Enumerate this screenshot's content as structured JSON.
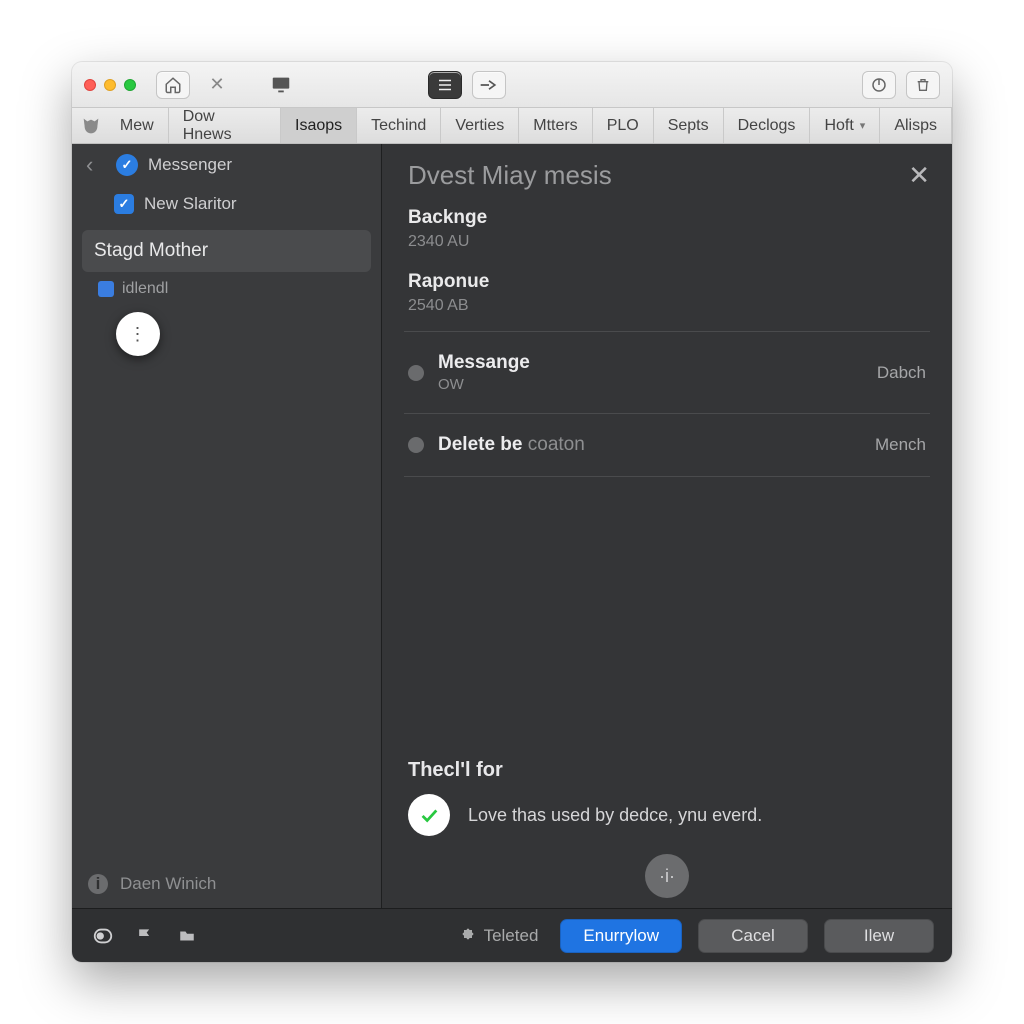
{
  "tabs": [
    "Mew",
    "Dow Hnews",
    "Isaops",
    "Techind",
    "Verties",
    "Mtters",
    "PLO",
    "Septs",
    "Declogs",
    "Hoft",
    "Alisps"
  ],
  "tabs_active_index": 2,
  "tabs_caret_index": 9,
  "sidebar": {
    "header": "Messenger",
    "new_item": "New Slaritor",
    "selected": "Stagd Mother",
    "sub_item": "idlendl",
    "footer": "Daen Winich"
  },
  "detail": {
    "title": "Dvest Miay mesis",
    "sections": [
      {
        "title": "Backnge",
        "sub": "2340 AU"
      },
      {
        "title": "Raponue",
        "sub": "2540 AB"
      }
    ],
    "rows": [
      {
        "title": "Messange",
        "title_muted": "",
        "sub": "OW",
        "right": "Dabch"
      },
      {
        "title": "Delete be",
        "title_muted": "coaton",
        "sub": "",
        "right": "Mench"
      }
    ],
    "thecl": "Thecl'l for",
    "confirm": "Love thas used by dedce, ynu everd."
  },
  "bottom": {
    "label": "Teleted",
    "primary": "Enurrylow",
    "cancel": "Cacel",
    "new": "Ilew"
  }
}
